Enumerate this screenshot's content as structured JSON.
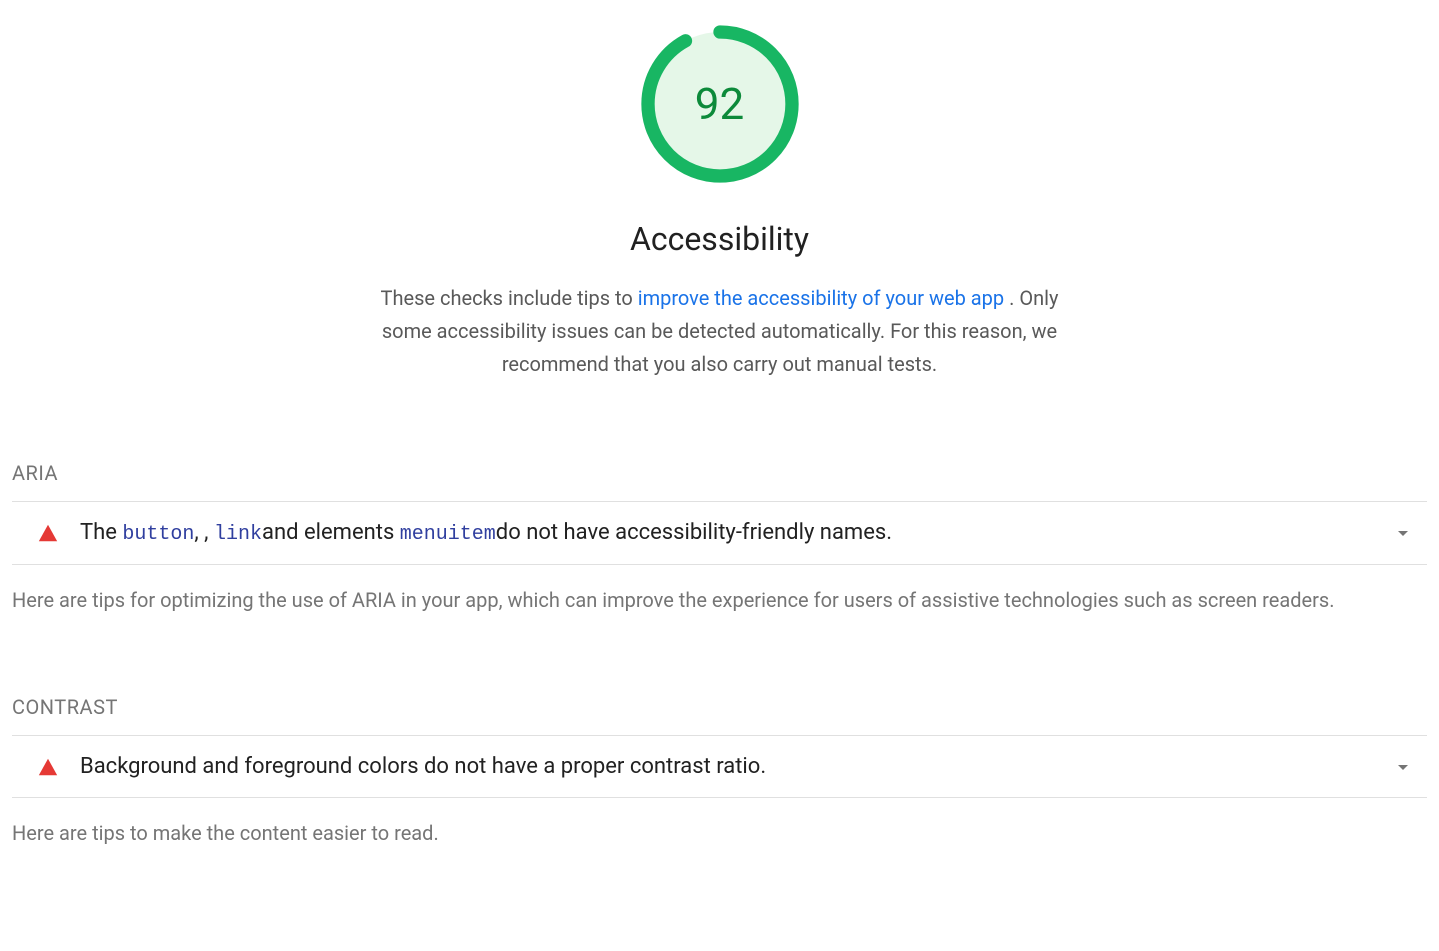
{
  "gauge": {
    "score": "92",
    "title": "Accessibility",
    "desc_prefix": "These checks include tips to ",
    "desc_link": "improve the accessibility of your web app",
    "desc_suffix": " . Only some accessibility issues can be detected automatically. For this reason, we recommend that you also carry out manual tests.",
    "arc_color": "#18b663",
    "score_color": "#0c8a3a"
  },
  "sections": [
    {
      "label": "ARIA",
      "audit": {
        "parts": [
          {
            "t": "text",
            "v": "The "
          },
          {
            "t": "code",
            "v": "button"
          },
          {
            "t": "text",
            "v": ", , "
          },
          {
            "t": "code",
            "v": "link"
          },
          {
            "t": "text",
            "v": "and elements "
          },
          {
            "t": "code",
            "v": "menuitem"
          },
          {
            "t": "text",
            "v": "do not have accessibility-friendly names."
          }
        ]
      },
      "tip": "Here are tips for optimizing the use of ARIA in your app, which can improve the experience for users of assistive technologies such as screen readers."
    },
    {
      "label": "CONTRAST",
      "audit": {
        "parts": [
          {
            "t": "text",
            "v": "Background and foreground colors do not have a proper contrast ratio."
          }
        ]
      },
      "tip": "Here are tips to make the content easier to read."
    }
  ]
}
